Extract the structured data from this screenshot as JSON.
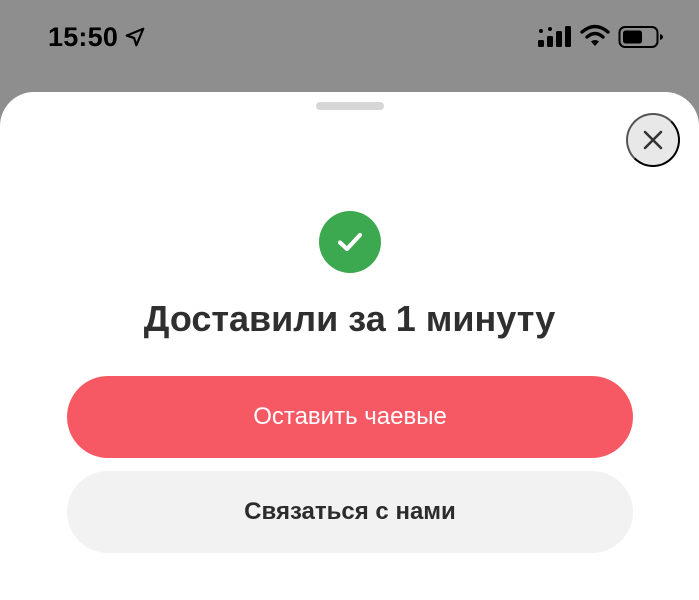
{
  "status_bar": {
    "time": "15:50",
    "icons": [
      "location-arrow-icon",
      "cellular-signal-icon",
      "wifi-icon",
      "battery-icon"
    ]
  },
  "sheet": {
    "close_icon": "close-icon",
    "success_icon": "checkmark-icon",
    "title": "Доставили за 1 минуту",
    "primary_button_label": "Оставить чаевые",
    "secondary_button_label": "Связаться с нами"
  },
  "colors": {
    "backdrop": "#8e8e8e",
    "sheet": "#ffffff",
    "success_green": "#3ca84f",
    "primary_button": "#f75964",
    "secondary_button": "#f2f2f2",
    "close_button": "#e8e8e8"
  }
}
